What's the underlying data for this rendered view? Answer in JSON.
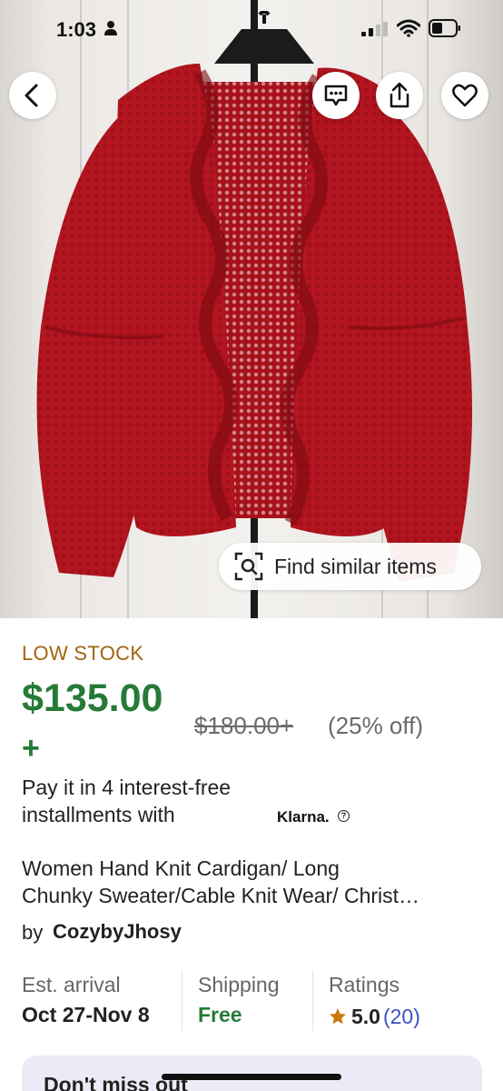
{
  "status_bar": {
    "time": "1:03"
  },
  "image": {
    "find_similar_label": "Find similar items"
  },
  "product": {
    "stock_label": "LOW STOCK",
    "price": "$135.00",
    "price_plus": "+",
    "original_price": "$180.00+",
    "discount": "(25% off)",
    "installments_line1": "Pay it in 4 interest-free",
    "installments_line2": "installments with",
    "klarna_logo": "Klarna.",
    "klarna_info": "?",
    "title_line1": "Women Hand Knit Cardigan/ Long",
    "title_line2": "Chunky Sweater/Cable Knit Wear/ Christ…",
    "by_label": "by",
    "shop_name": "CozybyJhosy"
  },
  "stats": {
    "arrival_label": "Est. arrival",
    "arrival_value": "Oct 27-Nov 8",
    "shipping_label": "Shipping",
    "shipping_value": "Free",
    "ratings_label": "Ratings",
    "rating_value": "5.0",
    "rating_count": "(20)"
  },
  "promo": {
    "label": "Don't miss out"
  },
  "colors": {
    "price_green": "#267a37",
    "stock_orange": "#a0650d",
    "rating_count_blue": "#3c52c4",
    "star": "#c8780f",
    "sweater_red": "#b2151f",
    "promo_bg": "#eceaf6"
  },
  "icons": [
    "back-arrow-icon",
    "message-icon",
    "share-icon",
    "heart-icon",
    "visual-search-icon",
    "star-icon",
    "person-icon",
    "signal-icon",
    "wifi-icon",
    "battery-icon"
  ]
}
